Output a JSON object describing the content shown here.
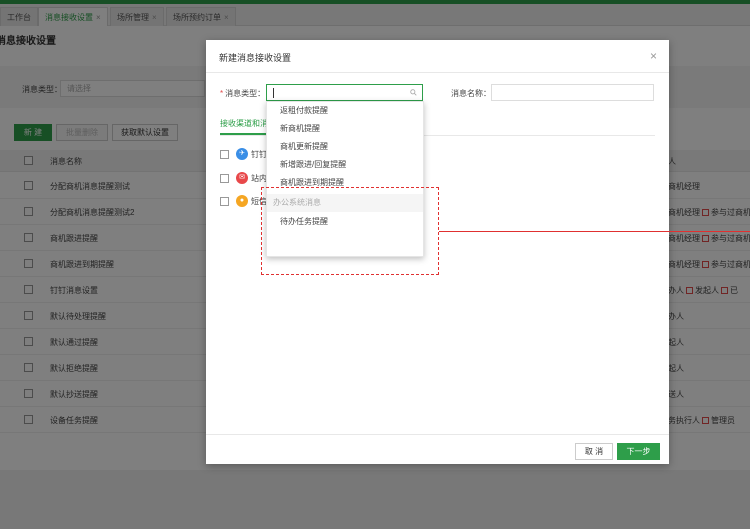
{
  "tabs": [
    {
      "label": "工作台",
      "closable": false,
      "active": false
    },
    {
      "label": "消息接收设置",
      "closable": true,
      "active": true
    },
    {
      "label": "场所管理",
      "closable": true,
      "active": false
    },
    {
      "label": "场所预约订单",
      "closable": true,
      "active": false
    }
  ],
  "page_title": "消息接收设置",
  "filter": {
    "label": "消息类型：",
    "placeholder": "请选择"
  },
  "toolbar": {
    "new_label": "新 建",
    "bulk_delete_label": "批量删除",
    "default_label": "获取默认设置"
  },
  "table": {
    "header_name": "消息名称",
    "header_receiver": "人",
    "rows": [
      {
        "name": "分配商机消息提醒测试",
        "receivers": [
          "商机经理"
        ]
      },
      {
        "name": "分配商机消息提醒测试2",
        "receivers": [
          "商机经理",
          "参与过商机"
        ]
      },
      {
        "name": "商机跟进提醒",
        "receivers": [
          "商机经理",
          "参与过商机"
        ]
      },
      {
        "name": "商机跟进到期提醒",
        "receivers": [
          "商机经理",
          "参与过商机"
        ]
      },
      {
        "name": "钉钉消息设置",
        "receivers": [
          "办人",
          "发起人",
          "已"
        ]
      },
      {
        "name": "默认待处理提醒",
        "receivers": [
          "办人"
        ]
      },
      {
        "name": "默认通过提醒",
        "receivers": [
          "起人"
        ]
      },
      {
        "name": "默认拒绝提醒",
        "receivers": [
          "起人"
        ]
      },
      {
        "name": "默认抄送提醒",
        "receivers": [
          "送人"
        ]
      },
      {
        "name": "设备任务提醒",
        "receivers": [
          "务执行人",
          "管理员"
        ]
      }
    ]
  },
  "modal": {
    "title": "新建消息接收设置",
    "type_label": "消息类型：",
    "name_label": "消息名称：",
    "channel_tab": "接收渠道和消",
    "channels": [
      {
        "label": "钉钉",
        "icon": "dingtalk-icon",
        "color": "#3a8ee6"
      },
      {
        "label": "站内",
        "icon": "mail-icon",
        "color": "#e8484a"
      },
      {
        "label": "短信",
        "icon": "sms-icon",
        "color": "#f5a623"
      }
    ],
    "cancel_label": "取 消",
    "next_label": "下一步"
  },
  "dropdown": {
    "items": [
      "返租付款提醒",
      "新商机提醒",
      "商机更新提醒",
      "新增跟进/回复提醒",
      "商机跟进到期提醒"
    ],
    "group_label": "办公系统消息",
    "group_items": [
      "待办任务提醒"
    ]
  },
  "colors": {
    "brand": "#2e9e4a",
    "annotation": "#e03030"
  }
}
